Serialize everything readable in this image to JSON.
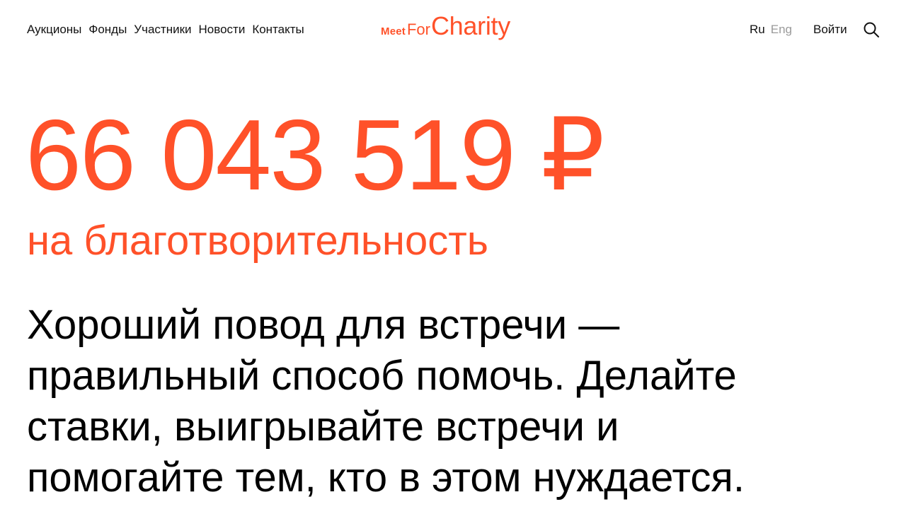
{
  "nav": {
    "items": [
      "Аукционы",
      "Фонды",
      "Участники",
      "Новости",
      "Контакты"
    ]
  },
  "logo": {
    "meet": "Meet",
    "for": "For",
    "charity": "Charity"
  },
  "lang": {
    "ru": "Ru",
    "eng": "Eng"
  },
  "auth": {
    "login_label": "Войти"
  },
  "icons": {
    "search": "search-icon"
  },
  "hero": {
    "amount": "66 043 519 ₽",
    "subtitle": "на благотворительность",
    "lead_lines": [
      "Хороший повод для встречи —",
      "правильный способ помочь. Делайте",
      "ставки, выигрывайте встречи и",
      "помогайте тем, кто в этом нуждается."
    ]
  },
  "colors": {
    "accent": "#ff5129",
    "text": "#000000",
    "muted": "#9a9a9a"
  }
}
